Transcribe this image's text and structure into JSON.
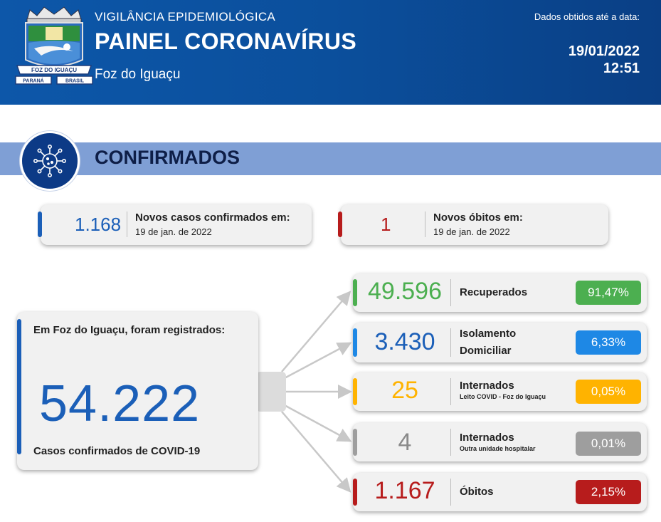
{
  "header": {
    "subtitle": "VIGILÂNCIA EPIDEMIOLÓGICA",
    "title": "PAINEL CORONAVÍRUS",
    "city": "Foz do Iguaçu",
    "date_label": "Dados obtidos até a data:",
    "date": "19/01/2022",
    "time": "12:51",
    "logo": {
      "name": "FOZ DO IGUAÇU",
      "state": "PARANÁ",
      "country": "BRASIL"
    }
  },
  "section": {
    "title": "CONFIRMADOS",
    "icon": "virus-icon"
  },
  "new_cases": {
    "value": "1.168",
    "label": "Novos casos confirmados em:",
    "date": "19 de jan. de 2022",
    "color": "#1b5fb8"
  },
  "new_deaths": {
    "value": "1",
    "label": "Novos óbitos em:",
    "date": "19 de jan. de 2022",
    "color": "#b71c1c"
  },
  "total": {
    "intro": "Em Foz do Iguaçu, foram registrados:",
    "value": "54.222",
    "footer": "Casos confirmados de COVID-19"
  },
  "breakdown": [
    {
      "value": "49.596",
      "label": "Recuperados",
      "label2": "",
      "sub": "",
      "percent": "91,47%",
      "color": "#4caf50"
    },
    {
      "value": "3.430",
      "label": "Isolamento",
      "label2": "Domiciliar",
      "sub": "",
      "percent": "6,33%",
      "color": "#1e88e5"
    },
    {
      "value": "25",
      "label": "Internados",
      "label2": "",
      "sub": "Leito COVID - Foz do Iguaçu",
      "percent": "0,05%",
      "color": "#ffb300"
    },
    {
      "value": "4",
      "label": "Internados",
      "label2": "",
      "sub": "Outra unidade hospitalar",
      "percent": "0,01%",
      "color": "#9e9e9e"
    },
    {
      "value": "1.167",
      "label": "Óbitos",
      "label2": "",
      "sub": "",
      "percent": "2,15%",
      "color": "#b71c1c"
    }
  ]
}
